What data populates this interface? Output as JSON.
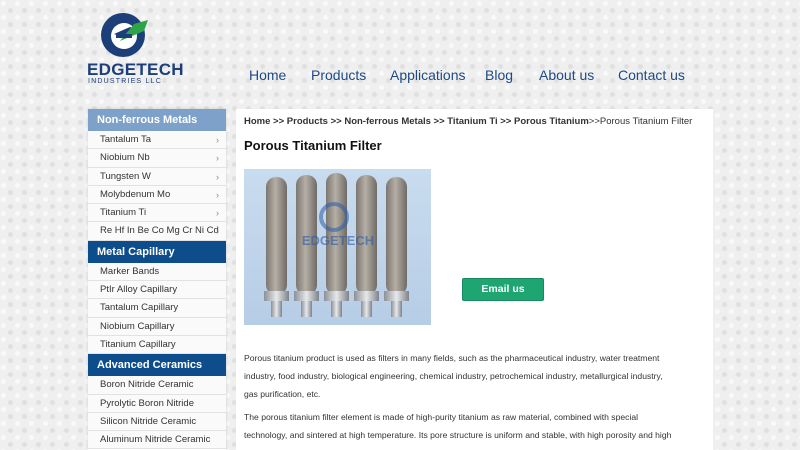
{
  "brand": {
    "name": "EDGETECH",
    "sub": "INDUSTRIES LLC",
    "colors": {
      "primary": "#1d3f79",
      "accent_green": "#2fa34a"
    }
  },
  "nav": [
    "Home",
    "Products",
    "Applications",
    "Blog",
    "About us",
    "Contact us"
  ],
  "sidebar": {
    "sections": [
      {
        "title": "Non-ferrous Metals",
        "items": [
          "Tantalum Ta",
          "Niobium Nb",
          "Tungsten W",
          "Molybdenum Mo",
          "Titanium Ti",
          "Re Hf In Be Co Mg Cr Ni Cd"
        ]
      },
      {
        "title": "Metal Capillary",
        "items": [
          "Marker Bands",
          "PtIr Alloy Capillary",
          "Tantalum Capillary",
          "Niobium Capillary",
          "Titanium Capillary"
        ]
      },
      {
        "title": "Advanced Ceramics",
        "items": [
          "Boron Nitride Ceramic",
          "Pyrolytic Boron Nitride",
          "Silicon Nitride Ceramic",
          "Aluminum Nitride Ceramic"
        ]
      }
    ]
  },
  "breadcrumb": {
    "items": [
      "Home",
      "Products",
      "Non-ferrous Metals",
      "Titanium Ti",
      "Porous Titanium"
    ],
    "current": "Porous Titanium Filter"
  },
  "page_title": "Porous Titanium Filter",
  "photo_watermark": "EDGETECH",
  "email_button": "Email us",
  "paragraphs": [
    {
      "lines": [
        "Porous titanium product is used as filters in many fields, such as the pharmaceutical industry, water treatment",
        "industry, food industry, biological engineering, chemical industry, petrochemical industry, metallurgical industry,",
        "gas purification, etc."
      ]
    },
    {
      "lines": [
        "The porous titanium filter element is made of high-purity titanium as raw material, combined with special",
        "technology, and sintered at high temperature. Its pore structure is uniform and stable, with high porosity and high"
      ]
    }
  ]
}
